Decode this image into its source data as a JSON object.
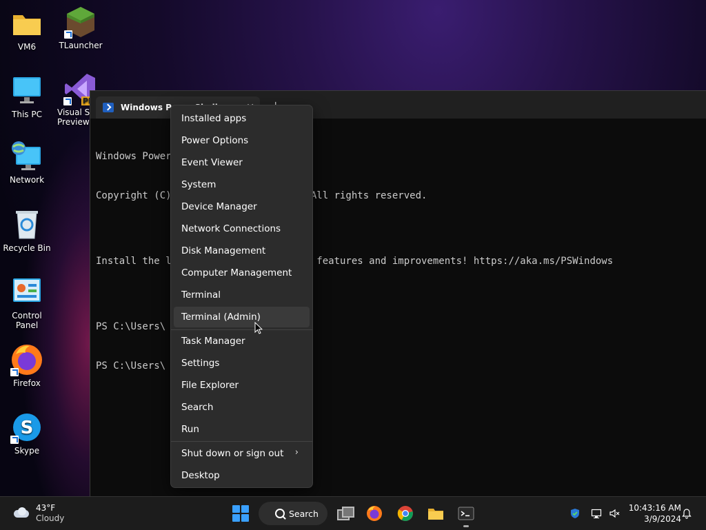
{
  "desktop": {
    "icons": [
      {
        "label": "VM6",
        "icon": "folder-icon"
      },
      {
        "label": "TLauncher",
        "icon": "minecraft-block-icon"
      },
      {
        "label": "This PC",
        "icon": "monitor-icon"
      },
      {
        "label": "Visual Studio 2022 Preview",
        "icon": "visual-studio-icon",
        "badge": "PRE"
      },
      {
        "label": "Network",
        "icon": "network-globe-icon"
      },
      {
        "label": "Recycle Bin",
        "icon": "recycle-bin-icon"
      },
      {
        "label": "Control Panel",
        "icon": "control-panel-icon"
      },
      {
        "label": "Firefox",
        "icon": "firefox-icon"
      },
      {
        "label": "Skype",
        "icon": "skype-icon"
      }
    ]
  },
  "terminal": {
    "tab_title": "Windows PowerShell",
    "close_glyph": "✕",
    "new_tab_glyph": "+",
    "lines": [
      "Windows PowerShell",
      "Copyright (C) Microsoft Corporation. All rights reserved.",
      "",
      "Install the latest PowerShell for new features and improvements! https://aka.ms/PSWindows",
      "",
      "PS C:\\Users\\",
      "PS C:\\Users\\"
    ]
  },
  "context_menu": {
    "items": [
      "Installed apps",
      "Power Options",
      "Event Viewer",
      "System",
      "Device Manager",
      "Network Connections",
      "Disk Management",
      "Computer Management",
      "Terminal",
      "Terminal (Admin)",
      "Task Manager",
      "Settings",
      "File Explorer",
      "Search",
      "Run",
      "Shut down or sign out",
      "Desktop"
    ],
    "hovered": "Terminal (Admin)",
    "submenu_glyph": "›"
  },
  "taskbar": {
    "weather": {
      "temp": "43°F",
      "condition": "Cloudy"
    },
    "search_label": "Search",
    "clock": {
      "time": "10:43:16 AM",
      "date": "3/9/2024"
    },
    "accent": "#3aa0ff"
  }
}
